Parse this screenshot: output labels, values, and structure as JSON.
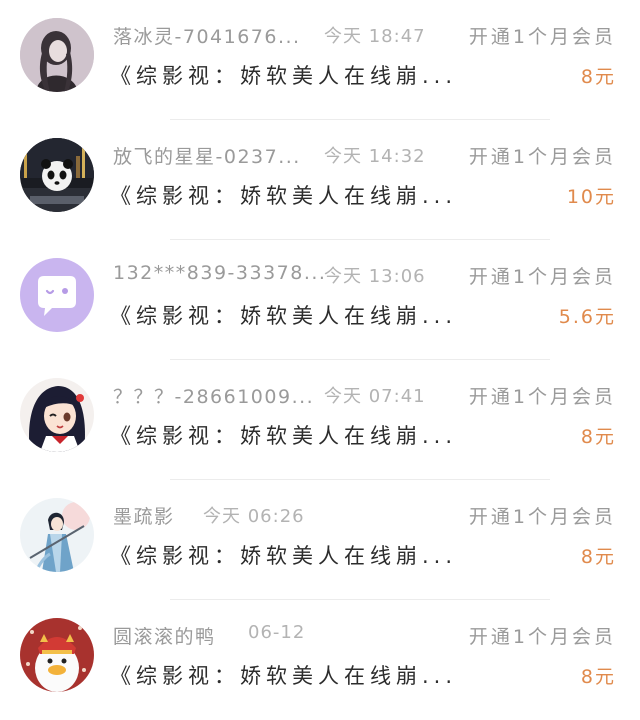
{
  "rows": [
    {
      "name": "落冰灵-7041676...",
      "time": "今天 18:47",
      "action": "开通1个月会员",
      "title": "《综影视：娇软美人在线崩...",
      "price": "8元",
      "avatar_icon": "girl-portrait-avatar"
    },
    {
      "name": "放飞的星星-0237...",
      "time": "今天 14:32",
      "action": "开通1个月会员",
      "title": "《综影视：娇软美人在线崩...",
      "price": "10元",
      "avatar_icon": "panda-night-avatar"
    },
    {
      "name": "132***839-33378...",
      "time": "今天 13:06",
      "action": "开通1个月会员",
      "title": "《综影视：娇软美人在线崩...",
      "price": "5.6元",
      "avatar_icon": "chat-bubble-avatar"
    },
    {
      "name": "？？？-28661009...",
      "time": "今天 07:41",
      "action": "开通1个月会员",
      "title": "《综影视：娇软美人在线崩...",
      "price": "8元",
      "avatar_icon": "anime-girl-avatar"
    },
    {
      "name": "墨疏影",
      "time": "今天 06:26",
      "action": "开通1个月会员",
      "title": "《综影视：娇软美人在线崩...",
      "price": "8元",
      "avatar_icon": "swordsman-avatar"
    },
    {
      "name": "圆滚滚的鸭",
      "time": "06-12",
      "action": "开通1个月会员",
      "title": "《综影视：娇软美人在线崩...",
      "price": "8元",
      "avatar_icon": "duck-lion-avatar"
    }
  ],
  "colors": {
    "price": "#e08a4c",
    "meta": "#9a9a9a",
    "title": "#2d2d2d",
    "chat_avatar_bg": "#c9b5ef"
  }
}
